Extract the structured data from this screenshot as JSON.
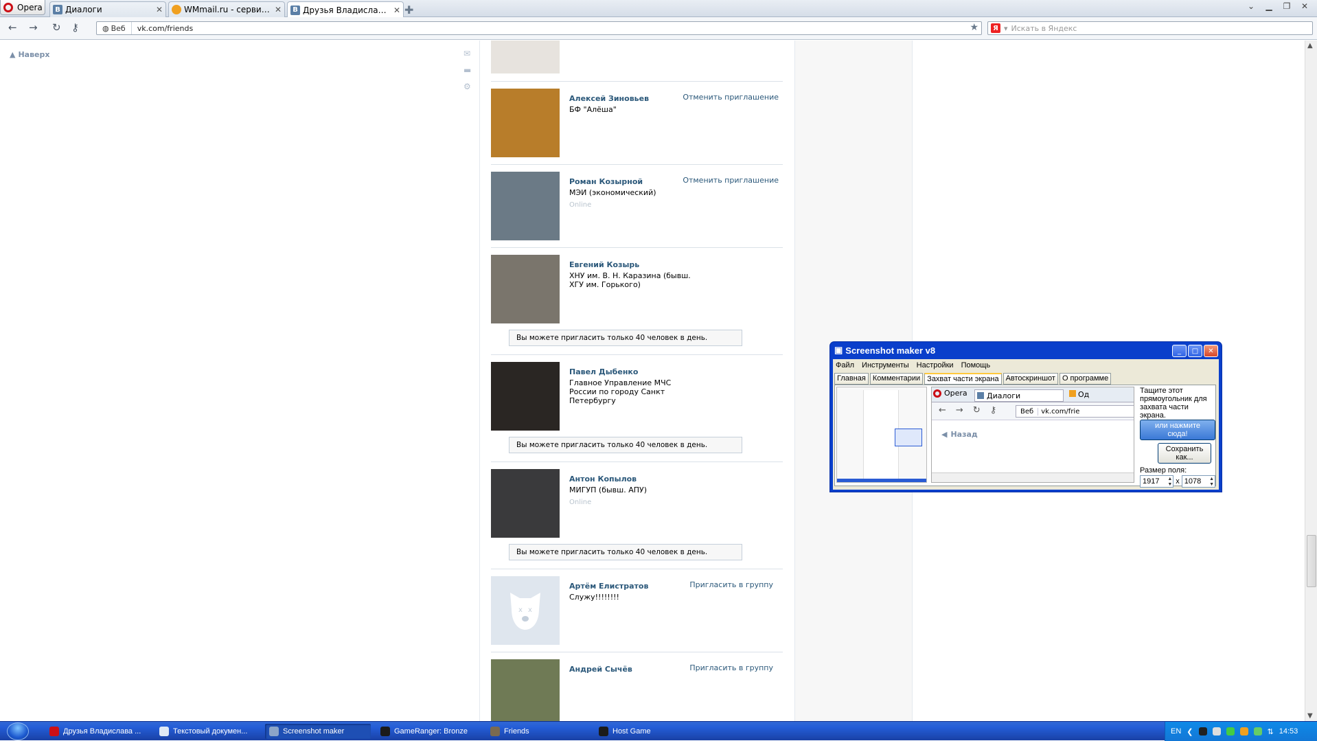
{
  "browser": {
    "menu_label": "Opera",
    "tabs": [
      {
        "label": "Диалоги",
        "icon": "vk-icon"
      },
      {
        "label": "WMmail.ru - сервис поч...",
        "icon": "wmmail-icon"
      },
      {
        "label": "Друзья Владислава Ку...",
        "icon": "vk-icon"
      }
    ],
    "address": {
      "web_label": "Веб",
      "url": "vk.com/friends"
    },
    "search_placeholder": "Искать в Яндекс"
  },
  "page": {
    "to_top": "Наверх",
    "friends": [
      {
        "name": "Алексей Зиновьев",
        "info": "БФ \"Алёша\"",
        "online": "",
        "action": "Отменить приглашение",
        "notice": "",
        "avatar_color": "#b87d2a"
      },
      {
        "name": "Роман Козырной",
        "info": "МЭИ (экономический)",
        "online": "Online",
        "action": "Отменить приглашение",
        "notice": "",
        "avatar_color": "#6b7a86"
      },
      {
        "name": "Евгений Козырь",
        "info": "ХНУ им. В. Н. Каразина (бывш. ХГУ им. Горького)",
        "online": "",
        "action": "",
        "notice": "Вы можете пригласить только 40 человек в день.",
        "avatar_color": "#7a756c"
      },
      {
        "name": "Павел Дыбенко",
        "info": "Главное Управление МЧС России по городу Санкт Петербургу",
        "online": "",
        "action": "",
        "notice": "Вы можете пригласить только 40 человек в день.",
        "avatar_color": "#2a2623"
      },
      {
        "name": "Антон Копылов",
        "info": "МИГУП (бывш. АПУ)",
        "online": "Online",
        "action": "",
        "notice": "Вы можете пригласить только 40 человек в день.",
        "avatar_color": "#3a3a3c"
      },
      {
        "name": "Артём Елистратов",
        "info": "Служу!!!!!!!!",
        "online": "",
        "action": "Пригласить в группу",
        "notice": "",
        "avatar_color": "#dfe6ee"
      },
      {
        "name": "Андрей Сычёв",
        "info": "",
        "online": "",
        "action": "Пригласить в группу",
        "notice": "",
        "avatar_color": "#6f7a55"
      }
    ]
  },
  "screenshot_maker": {
    "title": "Screenshot maker v8",
    "menu": [
      "Файл",
      "Инструменты",
      "Настройки",
      "Помощь"
    ],
    "tabs": [
      "Главная",
      "Комментарии",
      "Захват части экрана",
      "Автоскриншот",
      "О программе"
    ],
    "preview": {
      "opera": "Opera",
      "tab": "Диалоги",
      "tab2": "Од",
      "web": "Веб",
      "url": "vk.com/frie",
      "back": "Назад"
    },
    "hint": "Тащите этот прямоугольник для захвата части экрана.",
    "capture_button": "или нажмите сюда!",
    "save_button": "Сохранить как...",
    "size_label": "Размер поля:",
    "width": "1917",
    "x": "x",
    "height": "1078"
  },
  "taskbar": {
    "items": [
      {
        "label": "Друзья Владислава ...",
        "color": "#cc0f16"
      },
      {
        "label": "Текстовый докумен...",
        "color": "#dfe9f5"
      },
      {
        "label": "Screenshot maker",
        "color": "#8ca5c8"
      },
      {
        "label": "GameRanger: Bronze",
        "color": "#1b1b1b"
      },
      {
        "label": "Friends",
        "color": "#7a6a4f"
      },
      {
        "label": "Host Game",
        "color": "#1b1b1b"
      }
    ],
    "lang": "EN",
    "time": "14:53"
  }
}
